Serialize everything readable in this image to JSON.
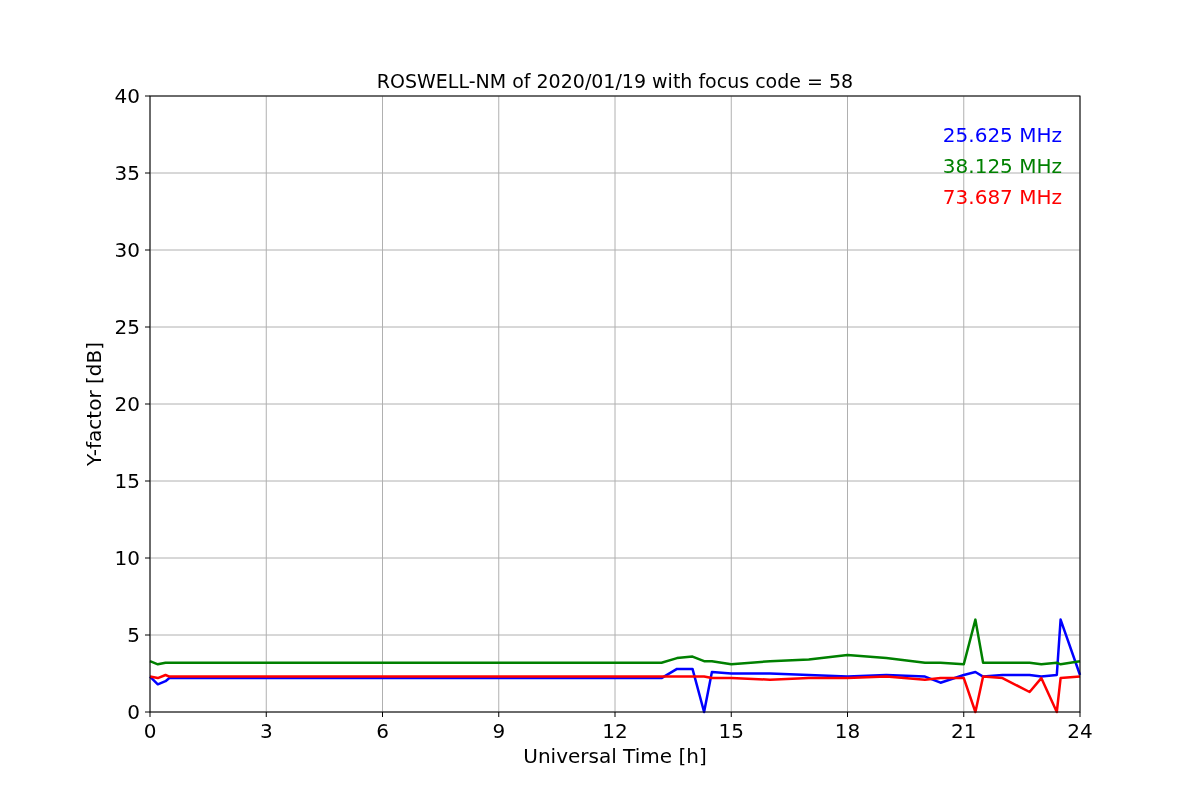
{
  "chart_data": {
    "type": "line",
    "grid": true,
    "title": "ROSWELL-NM of 2020/01/19 with focus code = 58",
    "xlabel": "Universal Time [h]",
    "ylabel": "Y-factor [dB]",
    "xlim": [
      0,
      24
    ],
    "ylim": [
      0,
      40
    ],
    "xticks": [
      0,
      3,
      6,
      9,
      12,
      15,
      18,
      21,
      24
    ],
    "yticks": [
      0,
      5,
      10,
      15,
      20,
      25,
      30,
      35,
      40
    ],
    "x": [
      0,
      0.2,
      0.4,
      0.5,
      13.2,
      13.6,
      14.0,
      14.3,
      14.5,
      15,
      16,
      17,
      18,
      19,
      20,
      20.4,
      21,
      21.3,
      21.5,
      22,
      22.7,
      23,
      23.4,
      23.5,
      24
    ],
    "series": [
      {
        "name": "25.625 MHz",
        "color": "#0000ff",
        "values": [
          2.3,
          1.8,
          2.0,
          2.2,
          2.2,
          2.8,
          2.8,
          0,
          2.6,
          2.5,
          2.5,
          2.4,
          2.3,
          2.4,
          2.3,
          1.9,
          2.4,
          2.6,
          2.3,
          2.4,
          2.4,
          2.3,
          2.4,
          6.0,
          2.4
        ]
      },
      {
        "name": "38.125 MHz",
        "color": "#008000",
        "values": [
          3.3,
          3.1,
          3.2,
          3.2,
          3.2,
          3.5,
          3.6,
          3.3,
          3.3,
          3.1,
          3.3,
          3.4,
          3.7,
          3.5,
          3.2,
          3.2,
          3.1,
          6.0,
          3.2,
          3.2,
          3.2,
          3.1,
          3.2,
          3.1,
          3.3
        ]
      },
      {
        "name": "73.687 MHz",
        "color": "#ff0000",
        "values": [
          2.3,
          2.2,
          2.4,
          2.3,
          2.3,
          2.3,
          2.3,
          2.3,
          2.2,
          2.2,
          2.1,
          2.2,
          2.2,
          2.3,
          2.1,
          2.2,
          2.2,
          0,
          2.3,
          2.2,
          1.3,
          2.2,
          0,
          2.2,
          2.3
        ]
      }
    ]
  }
}
